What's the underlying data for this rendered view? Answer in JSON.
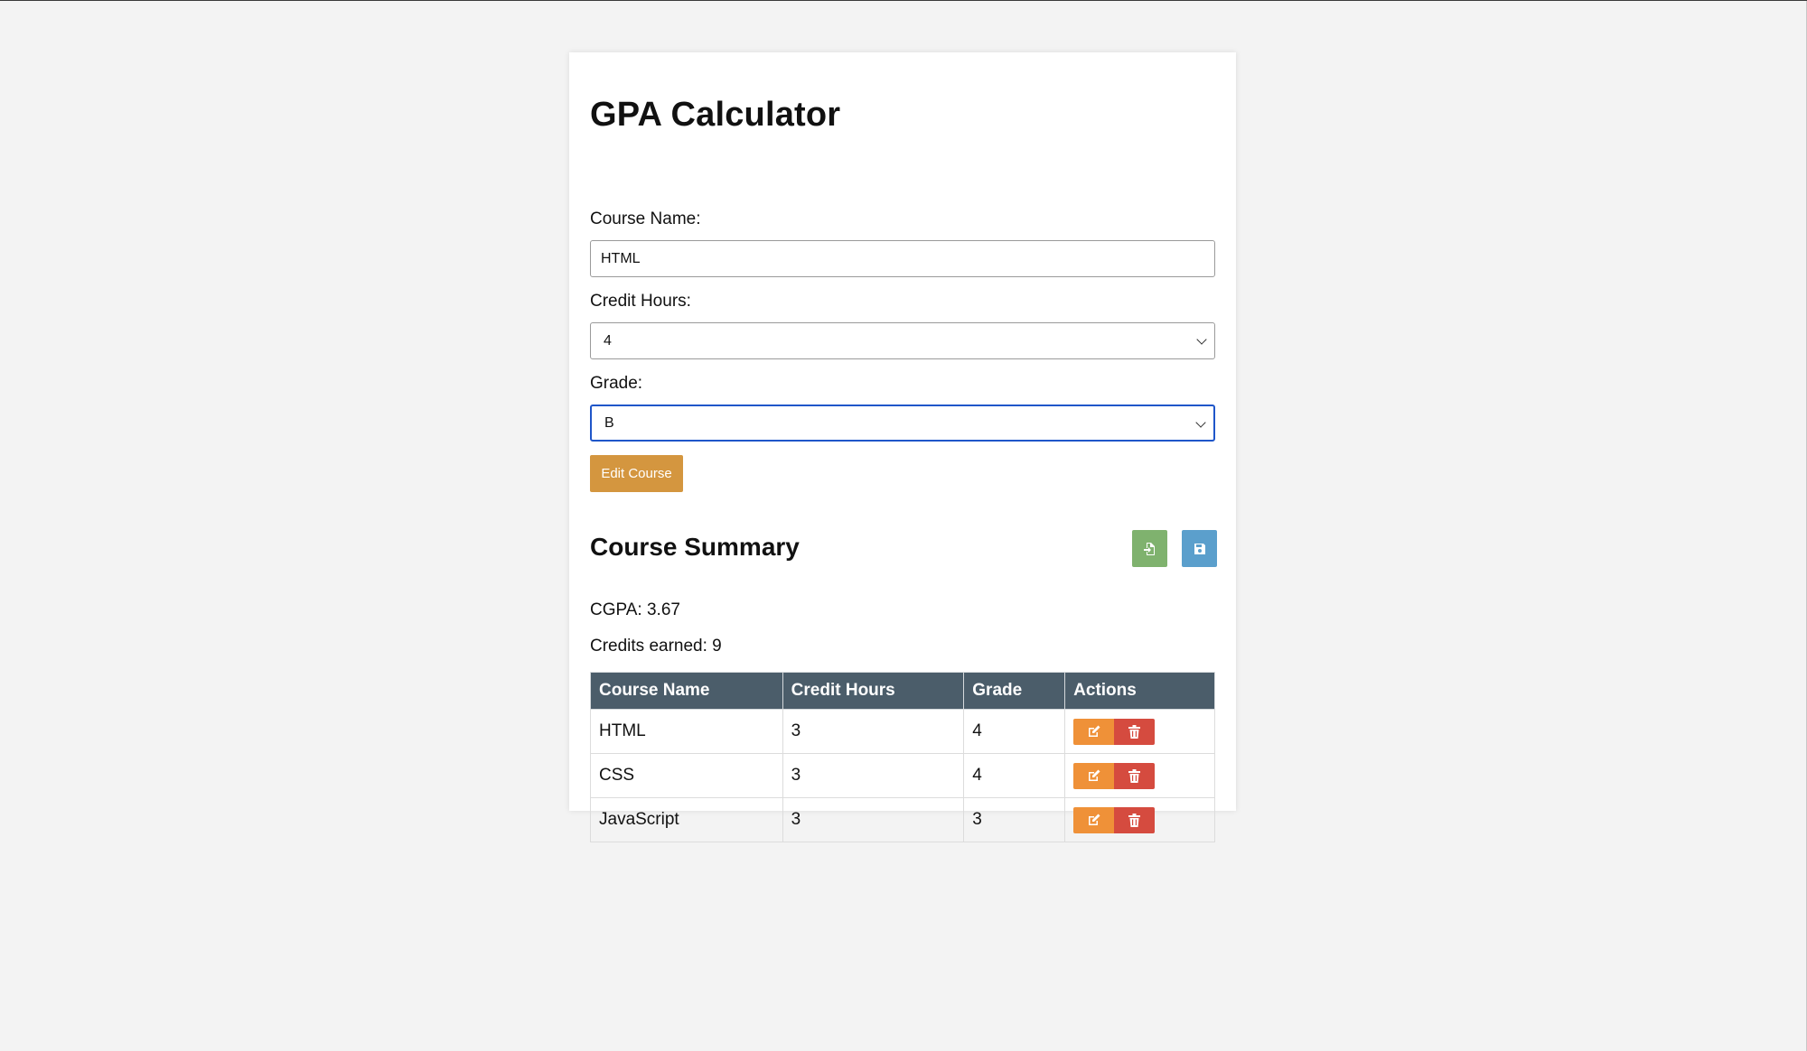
{
  "app": {
    "title": "GPA Calculator"
  },
  "form": {
    "course_name_label": "Course Name:",
    "course_name_value": "HTML",
    "credit_hours_label": "Credit Hours:",
    "credit_hours_value": "4",
    "grade_label": "Grade:",
    "grade_value": "B",
    "submit_label": "Edit Course"
  },
  "summary": {
    "title": "Course Summary",
    "cgpa_text": "CGPA: 3.67",
    "credits_text": "Credits earned: 9",
    "import_icon": "file-import-icon",
    "save_icon": "floppy-disk-icon"
  },
  "table": {
    "columns": [
      "Course Name",
      "Credit Hours",
      "Grade",
      "Actions"
    ],
    "rows": [
      {
        "name": "HTML",
        "credit_hours": "3",
        "grade": "4"
      },
      {
        "name": "CSS",
        "credit_hours": "3",
        "grade": "4"
      },
      {
        "name": "JavaScript",
        "credit_hours": "3",
        "grade": "3"
      }
    ]
  },
  "colors": {
    "page_bg": "#f3f3f3",
    "edit_course_button": "#d4963f",
    "import_button": "#7fb26e",
    "save_button": "#5b9fcc",
    "table_header": "#4b5d6a",
    "row_edit_button": "#ef9138",
    "row_delete_button": "#d54b3f",
    "focus_border": "#1f56c9"
  }
}
